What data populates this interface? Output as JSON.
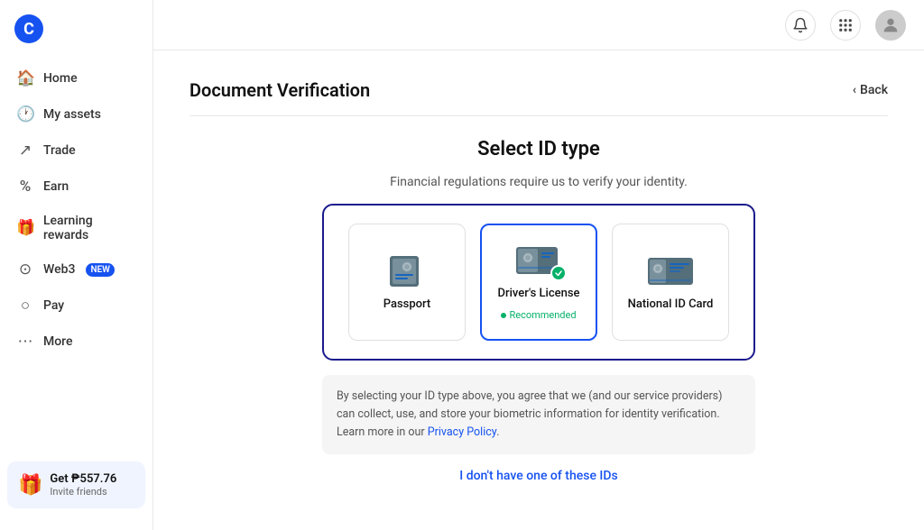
{
  "app": {
    "logo_letter": "C"
  },
  "sidebar": {
    "items": [
      {
        "id": "home",
        "label": "Home",
        "icon": "⌂"
      },
      {
        "id": "my-assets",
        "label": "My assets",
        "icon": "◷"
      },
      {
        "id": "trade",
        "label": "Trade",
        "icon": "↗"
      },
      {
        "id": "earn",
        "label": "Earn",
        "icon": "%"
      },
      {
        "id": "learning-rewards",
        "label": "Learning rewards",
        "icon": "☁"
      },
      {
        "id": "web3",
        "label": "Web3",
        "icon": "⊙",
        "badge": "NEW"
      },
      {
        "id": "pay",
        "label": "Pay",
        "icon": "○"
      },
      {
        "id": "more",
        "label": "More",
        "icon": "⋯"
      }
    ],
    "bottom": {
      "title": "Get ₱557.76",
      "subtitle": "Invite friends"
    }
  },
  "topbar": {
    "bell_icon": "bell",
    "grid_icon": "grid",
    "avatar_icon": "user"
  },
  "page": {
    "title": "Document Verification",
    "back_label": "Back"
  },
  "select_id": {
    "title": "Select ID type",
    "subtitle": "Financial regulations require us to verify your identity.",
    "cards": [
      {
        "id": "passport",
        "label": "Passport",
        "recommended": false
      },
      {
        "id": "drivers-license",
        "label": "Driver's License",
        "recommended": true,
        "recommended_text": "Recommended"
      },
      {
        "id": "national-id",
        "label": "National ID Card",
        "recommended": false
      }
    ],
    "disclaimer": "By selecting your ID type above, you agree that we (and our service providers) can collect, use, and store your biometric information for identity verification. Learn more in our ",
    "disclaimer_link": "Privacy Policy",
    "disclaimer_end": ".",
    "no_id_label": "I don't have one of these IDs"
  }
}
